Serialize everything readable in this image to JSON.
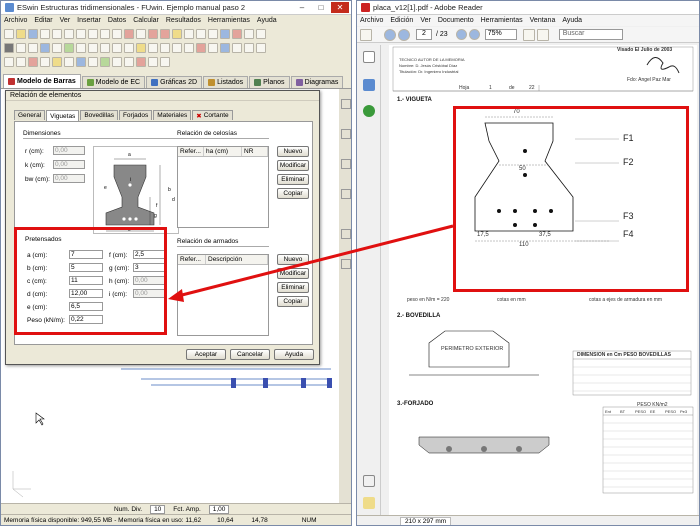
{
  "left_window": {
    "title": "ESwin Estructuras tridimensionales - FUwin. Ejemplo manual paso 2",
    "menu": [
      "Archivo",
      "Editar",
      "Ver",
      "Insertar",
      "Datos",
      "Calcular",
      "Resultados",
      "Herramientas",
      "Ayuda"
    ],
    "tabs": [
      {
        "label": "Modelo de Barras",
        "active": true
      },
      {
        "label": "Modelo de EC",
        "active": false
      },
      {
        "label": "Gráficas 2D",
        "active": false
      },
      {
        "label": "Listados",
        "active": false
      },
      {
        "label": "Planos",
        "active": false
      },
      {
        "label": "Diagramas",
        "active": false
      }
    ],
    "statusbar": {
      "num_div_label": "Num. Div.",
      "num_div_value": "10",
      "fct_amp_label": "Fct. Amp.",
      "fct_amp_value": "1,00",
      "memory_text": "Memoria física disponible: 949,55 MB - Memoria física en uso: 11,62",
      "coord_x": "10,64",
      "coord_y": "14,78",
      "num": "NUM"
    }
  },
  "dialog": {
    "title": "Relación de elementos",
    "tabs": [
      {
        "label": "General",
        "active": false
      },
      {
        "label": "Viguetas",
        "active": true
      },
      {
        "label": "Bovedillas",
        "active": false
      },
      {
        "label": "Forjados",
        "active": false
      },
      {
        "label": "Materiales",
        "active": false
      },
      {
        "label": "Cortante",
        "active": false
      }
    ],
    "dimensiones": {
      "title": "Dimensiones",
      "fields": [
        {
          "label": "r (cm):",
          "value": "0,00"
        },
        {
          "label": "k (cm):",
          "value": "0,00"
        },
        {
          "label": "bw (cm):",
          "value": "0,00"
        }
      ],
      "diagram_labels": [
        "a",
        "e",
        "c",
        "b",
        "d",
        "f",
        "g",
        "i"
      ]
    },
    "pretensados": {
      "title": "Pretensados",
      "left_fields": [
        {
          "label": "a (cm):",
          "value": "7"
        },
        {
          "label": "b (cm):",
          "value": "5"
        },
        {
          "label": "c (cm):",
          "value": "11"
        },
        {
          "label": "d (cm):",
          "value": "12,00"
        },
        {
          "label": "e (cm):",
          "value": "6,5"
        },
        {
          "label": "Peso (kN/m):",
          "value": "0,22"
        }
      ],
      "right_fields": [
        {
          "label": "f (cm):",
          "value": "2,5"
        },
        {
          "label": "g (cm):",
          "value": "3"
        },
        {
          "label": "h (cm):",
          "value": "0,00"
        },
        {
          "label": "i (cm):",
          "value": "0,00"
        }
      ]
    },
    "celosias": {
      "title": "Relación de celosías",
      "columns": [
        "Refer...",
        "ha (cm)",
        "NR"
      ],
      "buttons": [
        "Nuevo",
        "Modificar",
        "Eliminar",
        "Copiar"
      ]
    },
    "armados": {
      "title": "Relación de armados",
      "columns": [
        "Refer...",
        "Descripción"
      ],
      "buttons": [
        "Nuevo",
        "Modificar",
        "Eliminar",
        "Copiar"
      ]
    },
    "footer_buttons": [
      "Aceptar",
      "Cancelar",
      "Ayuda"
    ]
  },
  "right_window": {
    "title": "placa_v12[1].pdf - Adobe Reader",
    "menu": [
      "Archivo",
      "Edición",
      "Ver",
      "Documento",
      "Herramientas",
      "Ventana",
      "Ayuda"
    ],
    "page_current": "2",
    "page_total": "/ 23",
    "zoom": "75%",
    "search_placeholder": "Buscar",
    "statusbar_size": "210 x 297 mm",
    "doc": {
      "stamp": "Visado El Julio de 2003",
      "stamp2": "Fdo: Angel Paz Mar",
      "header_lines": [
        "TECNICO AUTOR DE LA MEMORIA",
        "Nombre: D. Jesús Cristóbal Díaz",
        "Titulación: Dr. Ingeniero Industrial"
      ],
      "hoja_label": "Hoja",
      "hoja_value": "1",
      "de_label": "de",
      "de_value": "22",
      "section1": "1.- VIGUETA",
      "dims": {
        "top": "70",
        "mid": "50",
        "bottom": "110",
        "left": "17,5",
        "right": "37,5"
      },
      "f_labels": [
        "F1",
        "F2",
        "F3",
        "F4"
      ],
      "caption_left": "peso en N/m = 220",
      "caption_mid": "cotas en mm",
      "caption_right": "cotas a ejes de armadura en mm",
      "section2": "2.- BOVEDILLA",
      "perimetro": "PERIMETRO EXTERIOR",
      "dim_table_title": "DIMENSION en Cm PESO BOVEDILLAS",
      "section3": "3.-FORJADO",
      "peso_table_title": "PESO KN/m2",
      "peso_cols": [
        "Ent",
        "BT",
        "PESO",
        "EE",
        "PESO",
        "Pe3"
      ]
    }
  },
  "colors": {
    "highlight": "#e01010",
    "pdf_bg": "#f0f0f0",
    "left_chrome": "#ece9d8"
  }
}
